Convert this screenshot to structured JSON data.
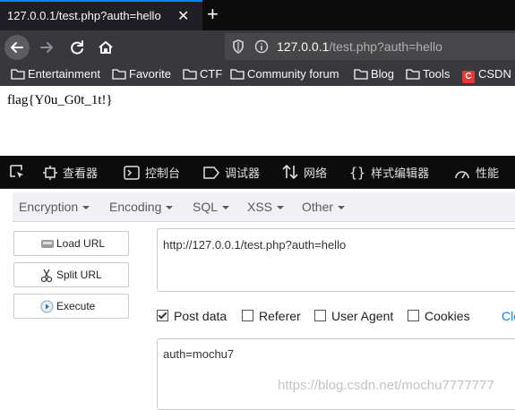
{
  "browser": {
    "tab": {
      "title": "127.0.0.1/test.php?auth=hello",
      "close": "✕"
    },
    "new_tab": "+",
    "url": {
      "host": "127.0.0.1",
      "path": "/test.php?auth=hello"
    },
    "bookmarks": [
      {
        "label": "Entertainment",
        "icon": "folder-icon"
      },
      {
        "label": "Favorite",
        "icon": "folder-icon"
      },
      {
        "label": "CTF",
        "icon": "folder-icon"
      },
      {
        "label": "Community forum",
        "icon": "folder-icon"
      },
      {
        "label": "Blog",
        "icon": "folder-icon"
      },
      {
        "label": "Tools",
        "icon": "folder-icon"
      },
      {
        "label": "CSDN",
        "icon": "csdn-icon"
      }
    ]
  },
  "page": {
    "flag": "flag{Y0u_G0t_1t!}"
  },
  "devtools": {
    "tabs": [
      "查看器",
      "控制台",
      "调试器",
      "网络",
      "样式编辑器",
      "性能"
    ]
  },
  "hackbar": {
    "menu": [
      "Encryption",
      "Encoding",
      "SQL",
      "XSS",
      "Other"
    ],
    "buttons": {
      "load": "Load URL",
      "split": "Split URL",
      "execute": "Execute"
    },
    "url_value": "http://127.0.0.1/test.php?auth=hello",
    "options": {
      "post": "Post data",
      "referer": "Referer",
      "user_agent": "User Agent",
      "cookies": "Cookies",
      "clear": "Cle"
    },
    "post_value": "auth=mochu7"
  },
  "watermark": "https://blog.csdn.net/mochu7777777",
  "colors": {
    "accent": "#0a84ff",
    "toolbar": "#38383d",
    "tabstrip": "#0c0c0d"
  }
}
